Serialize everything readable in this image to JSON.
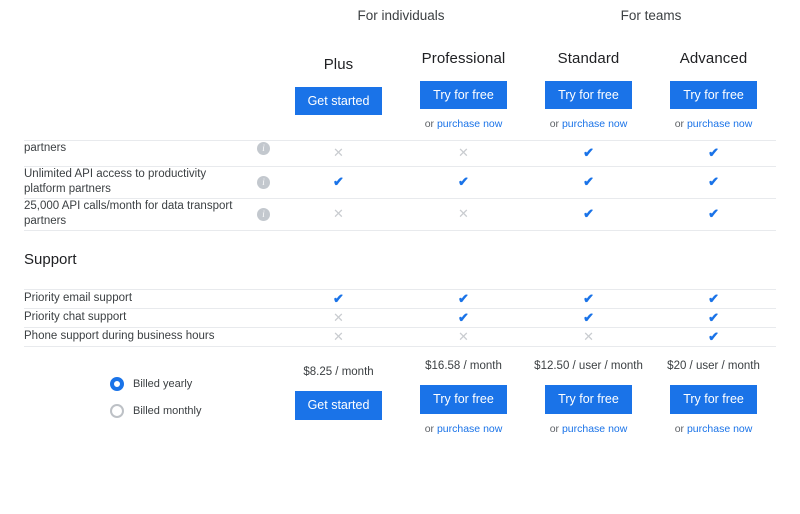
{
  "colors": {
    "accent": "#1a73e8",
    "yes_mark": "#1a73e8",
    "no_mark": "#c9ccd0",
    "text": "#3c4043",
    "border": "#e8eaed",
    "info_icon_bg": "#c3c8ce"
  },
  "group_headers": [
    {
      "label": "For individuals",
      "span": 2
    },
    {
      "label": "For teams",
      "span": 2
    }
  ],
  "plans": [
    {
      "name": "Plus",
      "cta": "Get started",
      "sub_prefix": "",
      "sub_link": "",
      "price": "$8.25 / month"
    },
    {
      "name": "Professional",
      "cta": "Try for free",
      "sub_prefix": "or",
      "sub_link": "purchase now",
      "price": "$16.58 / month"
    },
    {
      "name": "Standard",
      "cta": "Try for free",
      "sub_prefix": "or",
      "sub_link": "purchase now",
      "price": "$12.50 / user / month"
    },
    {
      "name": "Advanced",
      "cta": "Try for free",
      "sub_prefix": "or",
      "sub_link": "purchase now",
      "price": "$20 / user / month"
    }
  ],
  "feature_rows": [
    {
      "label": "partners",
      "has_info": true,
      "clipped": true,
      "marks": [
        "no",
        "no",
        "yes",
        "yes"
      ]
    },
    {
      "label": "Unlimited API access to productivity platform partners",
      "has_info": true,
      "clipped": false,
      "marks": [
        "yes",
        "yes",
        "yes",
        "yes"
      ]
    },
    {
      "label": "25,000 API calls/month for data transport partners",
      "has_info": true,
      "clipped": false,
      "marks": [
        "no",
        "no",
        "yes",
        "yes"
      ]
    }
  ],
  "section": {
    "title": "Support"
  },
  "support_rows": [
    {
      "label": "Priority email support",
      "has_info": false,
      "marks": [
        "yes",
        "yes",
        "yes",
        "yes"
      ]
    },
    {
      "label": "Priority chat support",
      "has_info": false,
      "marks": [
        "no",
        "yes",
        "yes",
        "yes"
      ]
    },
    {
      "label": "Phone support during business hours",
      "has_info": false,
      "marks": [
        "no",
        "no",
        "no",
        "yes"
      ]
    }
  ],
  "billing": {
    "options": [
      {
        "label": "Billed yearly",
        "selected": true
      },
      {
        "label": "Billed monthly",
        "selected": false
      }
    ]
  },
  "glyphs": {
    "check": "✔",
    "cross": "✕",
    "info": "i"
  }
}
